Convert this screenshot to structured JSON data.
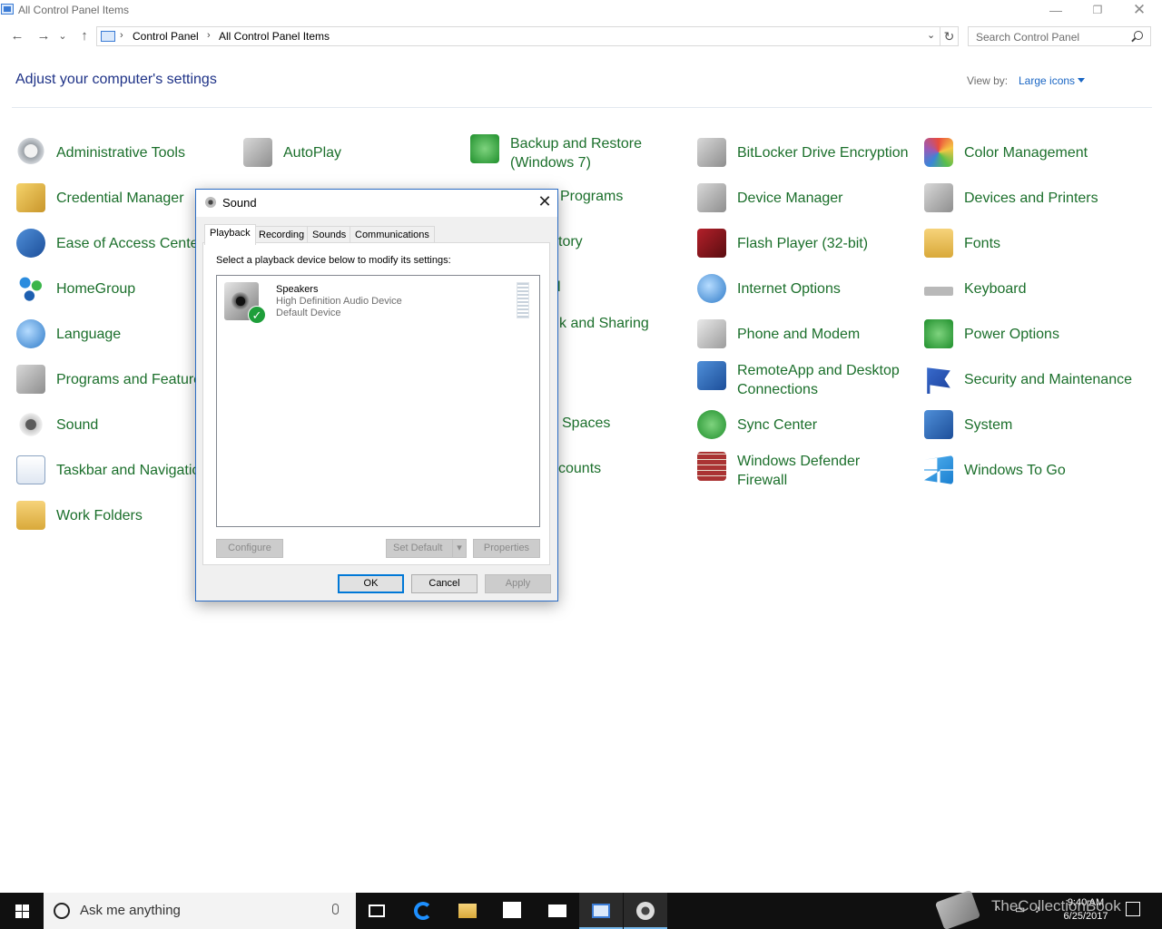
{
  "window": {
    "title": "All Control Panel Items",
    "min_glyph": "—",
    "max_glyph": "❐",
    "close_glyph": "✕"
  },
  "nav": {
    "back_glyph": "←",
    "forward_glyph": "→",
    "recent_glyph": "⌄",
    "up_glyph": "↑",
    "refresh_glyph": "↻",
    "dropdown_glyph": "⌄",
    "breadcrumb": [
      "Control Panel",
      "All Control Panel Items"
    ],
    "separator": "›",
    "search_placeholder": "Search Control Panel"
  },
  "header": {
    "title": "Adjust your computer's settings",
    "view_by_label": "View by:",
    "view_by_value": "Large icons"
  },
  "items": {
    "administrative_tools": "Administrative Tools",
    "autoplay": "AutoPlay",
    "backup_restore_1": "Backup and Restore",
    "backup_restore_2": "(Windows 7)",
    "bitlocker": "BitLocker Drive Encryption",
    "color_management": "Color Management",
    "credential_manager": "Credential Manager",
    "default_programs_partial": "Programs",
    "device_manager": "Device Manager",
    "devices_printers": "Devices and Printers",
    "ease_of_access": "Ease of Access Center",
    "file_history_partial": "tory",
    "flash_player": "Flash Player (32-bit)",
    "fonts": "Fonts",
    "homegroup": "HomeGroup",
    "indexing_partial": "l",
    "internet_options": "Internet Options",
    "keyboard": "Keyboard",
    "language": "Language",
    "network_sharing_partial": "k and Sharing",
    "phone_modem": "Phone and Modem",
    "power_options": "Power Options",
    "programs_features": "Programs and Features",
    "remoteapp_1": "RemoteApp and Desktop",
    "remoteapp_2": "Connections",
    "security_maintenance": "Security and Maintenance",
    "sound": "Sound",
    "storage_spaces_partial": "Spaces",
    "sync_center": "Sync Center",
    "system": "System",
    "taskbar_navigation": "Taskbar and Navigation",
    "user_accounts_partial": "counts",
    "defender_firewall_1": "Windows Defender",
    "defender_firewall_2": "Firewall",
    "windows_to_go": "Windows To Go",
    "work_folders": "Work Folders"
  },
  "sound_dialog": {
    "title": "Sound",
    "close_glyph": "✕",
    "tabs": [
      "Playback",
      "Recording",
      "Sounds",
      "Communications"
    ],
    "active_tab": "Playback",
    "instruction": "Select a playback device below to modify its settings:",
    "device": {
      "name": "Speakers",
      "description": "High Definition Audio Device",
      "status": "Default Device",
      "check_glyph": "✓"
    },
    "buttons": {
      "configure": "Configure",
      "set_default": "Set Default",
      "set_default_arrow": "▾",
      "properties": "Properties",
      "ok": "OK",
      "cancel": "Cancel",
      "apply": "Apply"
    }
  },
  "taskbar": {
    "search_placeholder": "Ask me anything",
    "time": "9:40 AM",
    "date": "6/25/2017",
    "watermark": "TheCollectionBook"
  }
}
